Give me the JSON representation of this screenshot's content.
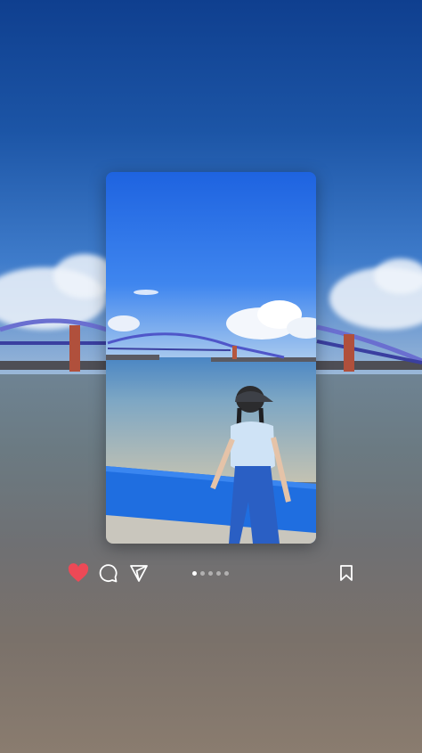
{
  "post": {
    "liked": true,
    "page_count": 5,
    "active_page": 1
  },
  "icons": {
    "like": "heart-icon",
    "comment": "comment-icon",
    "share": "send-icon",
    "save": "bookmark-icon"
  },
  "colors": {
    "like_active": "#ed4956",
    "icon": "#ffffff"
  }
}
